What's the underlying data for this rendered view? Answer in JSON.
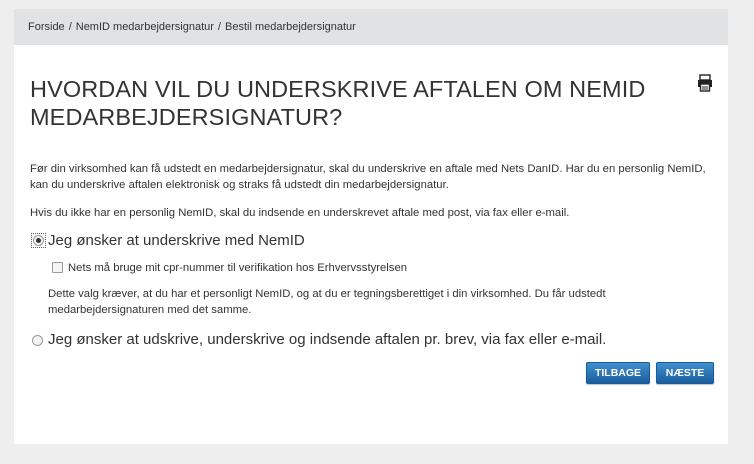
{
  "breadcrumb": {
    "items": [
      "Forside",
      "NemID medarbejdersignatur",
      "Bestil medarbejdersignatur"
    ],
    "separator": "/"
  },
  "page": {
    "title": "HVORDAN VIL DU UNDERSKRIVE AFTALEN OM NEMID MEDARBEJDERSIGNATUR?",
    "print_icon": "printer-icon",
    "intro": "Før din virksomhed kan få udstedt en medarbejdersignatur, skal du underskrive en aftale med Nets DanID. Har du en personlig NemID, kan du underskrive aftalen elektronisk og straks få udstedt din medarbejdersignatur.",
    "no_nemid_note": "Hvis du ikke har en personlig NemID, skal du indsende en underskrevet aftale med post, via fax eller e-mail."
  },
  "options": {
    "sign_nemid": {
      "label": "Jeg ønsker at underskrive med NemID",
      "selected": true,
      "cpr_checkbox_label": "Nets må bruge mit cpr-nummer til verifikation hos Erhvervsstyrelsen",
      "cpr_checked": false,
      "requirement_note": "Dette valg kræver, at du har et personligt NemID, og at du er tegningsberettiget i din virksomhed. Du får udstedt medarbejdersignaturen med det samme."
    },
    "sign_paper": {
      "label": "Jeg ønsker at udskrive, underskrive og indsende aftalen pr. brev, via fax eller e-mail.",
      "selected": false
    }
  },
  "buttons": {
    "back": "TILBAGE",
    "next": "NÆSTE"
  },
  "colors": {
    "button": "#2a72b5",
    "breadcrumb_bg": "#e1e2e4",
    "page_bg": "#eeeeef"
  }
}
